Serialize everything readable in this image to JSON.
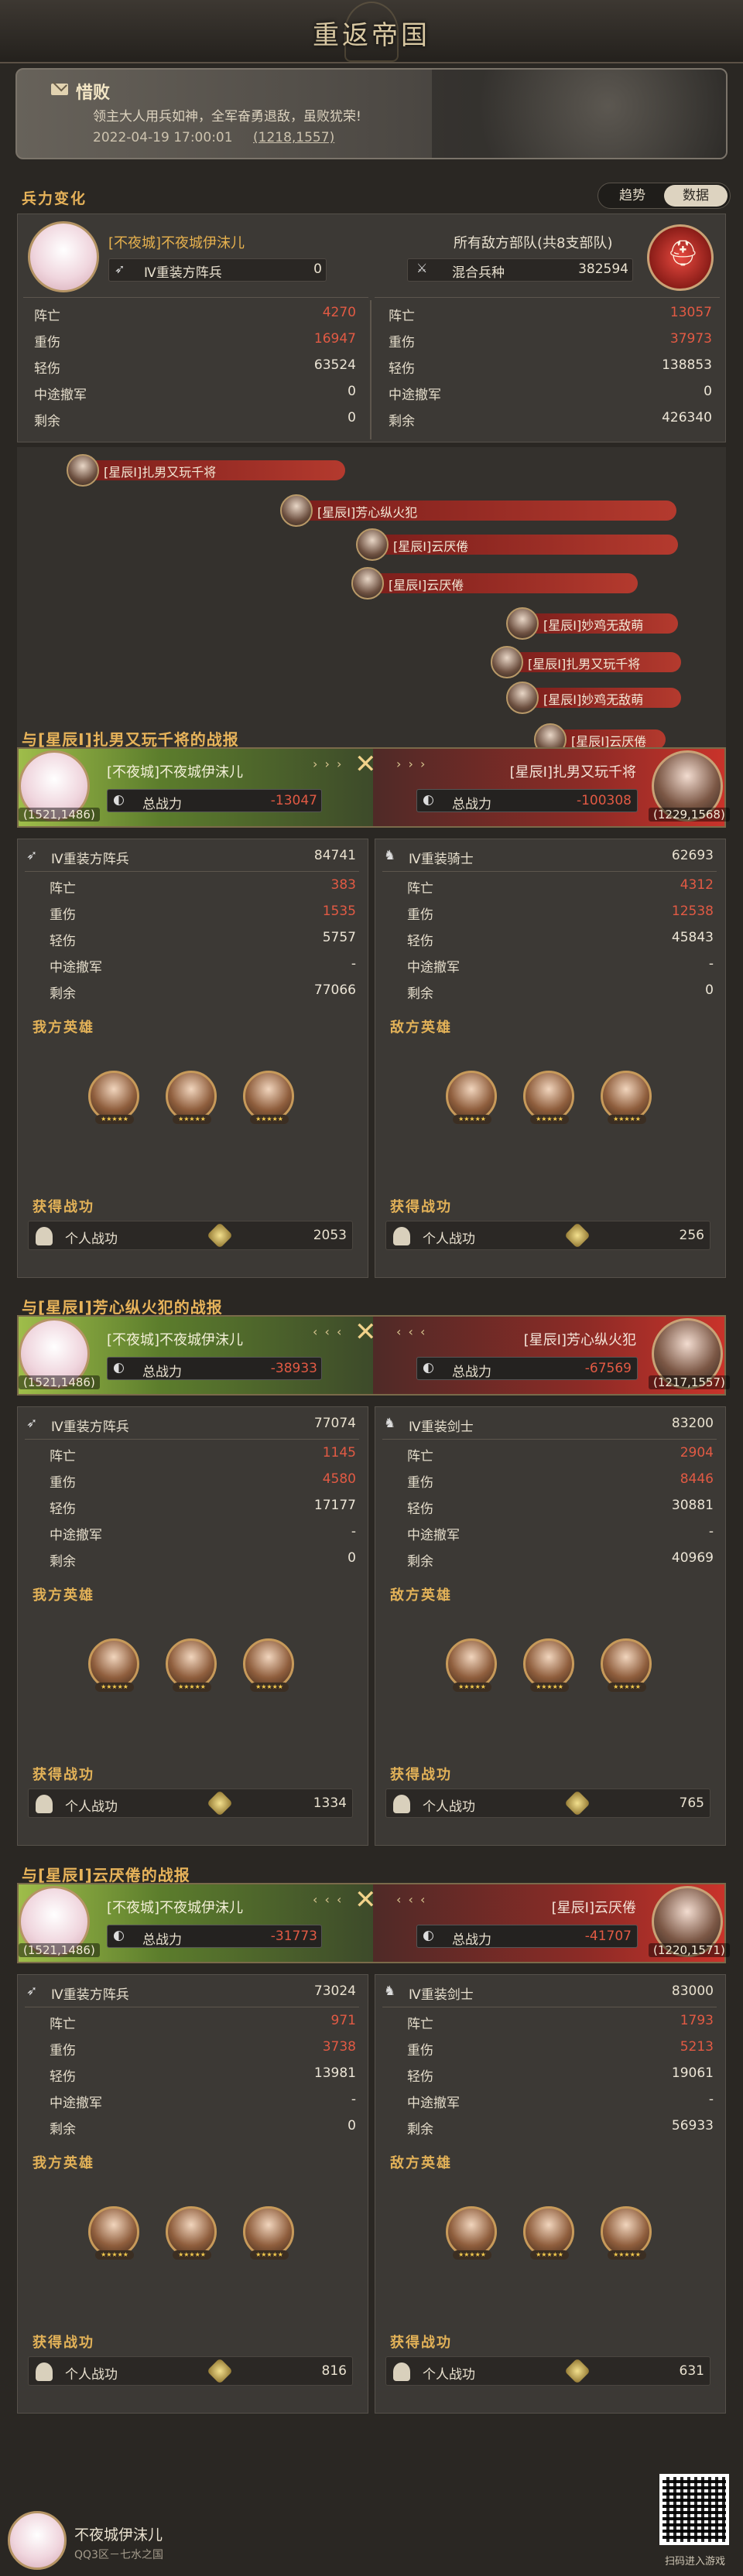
{
  "header": {
    "title": "重返帝国"
  },
  "report": {
    "title": "惜败",
    "message": "领主大人用兵如神，全军奋勇退敌，虽败犹荣!",
    "time": "2022-04-19 17:00:01",
    "coord": "(1218,1557)"
  },
  "force_change": {
    "title": "兵力变化",
    "tabs": [
      "趋势",
      "数据"
    ],
    "active_tab": "数据",
    "mine": {
      "name": "[不夜城]不夜城伊沫儿",
      "unit": "Ⅳ重装方阵兵",
      "unit_count": "0"
    },
    "enemy": {
      "name": "所有敌方部队(共8支部队)",
      "unit": "混合兵种",
      "unit_count": "382594"
    },
    "rows": [
      "阵亡",
      "重伤",
      "轻伤",
      "中途撤军",
      "剩余"
    ],
    "mine_vals": [
      "4270",
      "16947",
      "63524",
      "0",
      "0"
    ],
    "enemy_vals": [
      "13057",
      "37973",
      "138853",
      "0",
      "426340"
    ]
  },
  "timeline": [
    {
      "label": "[星辰Ⅰ]扎男又玩千将"
    },
    {
      "label": "[星辰Ⅰ]芳心纵火犯"
    },
    {
      "label": "[星辰Ⅰ]云厌倦"
    },
    {
      "label": "[星辰Ⅰ]云厌倦"
    },
    {
      "label": "[星辰Ⅰ]妙鸡无敌萌"
    },
    {
      "label": "[星辰Ⅰ]扎男又玩千将"
    },
    {
      "label": "[星辰Ⅰ]妙鸡无敌萌"
    },
    {
      "label": "[星辰Ⅰ]云厌倦"
    }
  ],
  "labels": {
    "total_power": "总战力",
    "my_heroes": "我方英雄",
    "enemy_heroes": "敌方英雄",
    "merit_title": "获得战功",
    "personal_merit": "个人战功",
    "stars": "★★★★★"
  },
  "battles": [
    {
      "title": "与[星辰Ⅰ]扎男又玩千将的战报",
      "arrows": "› › ›",
      "arrows_r": "› › ›",
      "my_name": "[不夜城]不夜城伊沫儿",
      "my_coord": "(1521,1486)",
      "my_power": "-13047",
      "enemy_name": "[星辰Ⅰ]扎男又玩千将",
      "enemy_coord": "(1229,1568)",
      "enemy_power": "-100308",
      "my_unit": "Ⅳ重装方阵兵",
      "my_unit_count": "84741",
      "enemy_unit": "Ⅳ重装骑士",
      "enemy_unit_count": "62693",
      "my_vals": [
        "383",
        "1535",
        "5757",
        "-",
        "77066"
      ],
      "enemy_vals": [
        "4312",
        "12538",
        "45843",
        "-",
        "0"
      ],
      "my_merit": "2053",
      "enemy_merit": "256"
    },
    {
      "title": "与[星辰Ⅰ]芳心纵火犯的战报",
      "arrows": "‹ ‹ ‹",
      "arrows_r": "‹ ‹ ‹",
      "my_name": "[不夜城]不夜城伊沫儿",
      "my_coord": "(1521,1486)",
      "my_power": "-38933",
      "enemy_name": "[星辰Ⅰ]芳心纵火犯",
      "enemy_coord": "(1217,1557)",
      "enemy_power": "-67569",
      "my_unit": "Ⅳ重装方阵兵",
      "my_unit_count": "77074",
      "enemy_unit": "Ⅳ重装剑士",
      "enemy_unit_count": "83200",
      "my_vals": [
        "1145",
        "4580",
        "17177",
        "-",
        "0"
      ],
      "enemy_vals": [
        "2904",
        "8446",
        "30881",
        "-",
        "40969"
      ],
      "my_merit": "1334",
      "enemy_merit": "765"
    },
    {
      "title": "与[星辰Ⅰ]云厌倦的战报",
      "arrows": "‹ ‹ ‹",
      "arrows_r": "‹ ‹ ‹",
      "my_name": "[不夜城]不夜城伊沫儿",
      "my_coord": "(1521,1486)",
      "my_power": "-31773",
      "enemy_name": "[星辰Ⅰ]云厌倦",
      "enemy_coord": "(1220,1571)",
      "enemy_power": "-41707",
      "my_unit": "Ⅳ重装方阵兵",
      "my_unit_count": "73024",
      "enemy_unit": "Ⅳ重装剑士",
      "enemy_unit_count": "83000",
      "my_vals": [
        "971",
        "3738",
        "13981",
        "-",
        "0"
      ],
      "enemy_vals": [
        "1793",
        "5213",
        "19061",
        "-",
        "56933"
      ],
      "my_merit": "816",
      "enemy_merit": "631"
    }
  ],
  "footer": {
    "name": "不夜城伊沫儿",
    "server": "QQ3区－七水之国",
    "qr_caption": "扫码进入游戏"
  },
  "colors": {
    "accent": "#e8b24e",
    "loss_red": "#e25a44",
    "ally_green": "#7aa23a",
    "enemy_red": "#c9332a"
  }
}
